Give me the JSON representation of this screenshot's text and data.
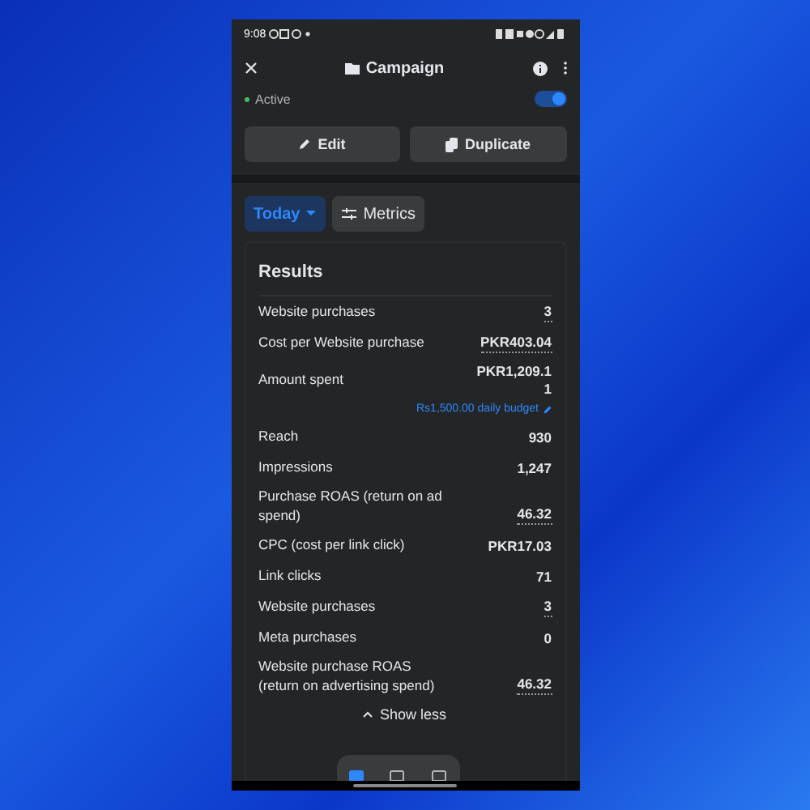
{
  "status_bar": {
    "time": "9:08"
  },
  "header": {
    "title": "Campaign"
  },
  "status": {
    "label": "Active",
    "on": true
  },
  "actions": [
    {
      "label": "Edit",
      "kind": "edit"
    },
    {
      "label": "Duplicate",
      "kind": "duplicate"
    }
  ],
  "filters": [
    {
      "label": "Today",
      "kind": "dropdown"
    },
    {
      "label": "Metrics",
      "kind": "metrics"
    }
  ],
  "results": {
    "title": "Results",
    "rows": [
      {
        "label": "Website purchases",
        "value": "3",
        "underlined": true
      },
      {
        "label": "Cost per Website purchase",
        "value": "PKR403.04",
        "underlined": true
      },
      {
        "label": "Amount spent",
        "value": "PKR1,209.1\n1",
        "underlined": false,
        "budget": "Rs1,500.00 daily budget"
      },
      {
        "label": "Reach",
        "value": "930",
        "underlined": false
      },
      {
        "label": "Impressions",
        "value": "1,247",
        "underlined": false
      },
      {
        "label": "Purchase ROAS (return on ad spend)",
        "value": "46.32",
        "underlined": true
      },
      {
        "label": "CPC (cost per link click)",
        "value": "PKR17.03",
        "underlined": false
      },
      {
        "label": "Link clicks",
        "value": "71",
        "underlined": false
      },
      {
        "label": "Website purchases",
        "value": "3",
        "underlined": true
      },
      {
        "label": "Meta purchases",
        "value": "0",
        "underlined": false
      },
      {
        "label": "Website purchase ROAS (return on advertising spend)",
        "value": "46.32",
        "underlined": true
      }
    ],
    "toggle": "Show less"
  },
  "bottom_nav": [
    {
      "selected": true
    },
    {
      "selected": false
    },
    {
      "selected": false
    }
  ]
}
